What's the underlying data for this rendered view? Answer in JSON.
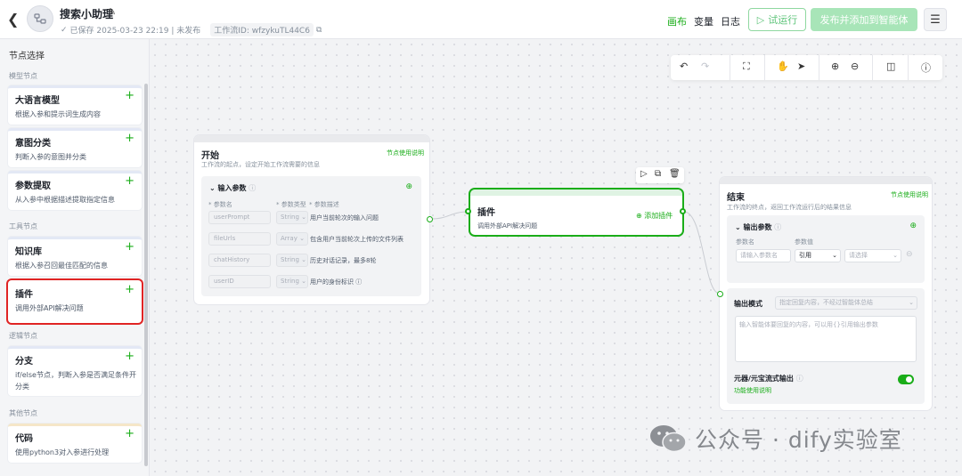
{
  "header": {
    "back": "<",
    "title": "搜索小助理",
    "meta_saved": "已保存 2025-03-23 22:19 | 未发布",
    "workflow_id": "工作流ID: wfzykuTL44C6",
    "tabs": [
      "画布",
      "变量",
      "日志"
    ],
    "active_tab": "画布",
    "run_label": "试运行",
    "publish_label": "发布并添加到智能体",
    "accent": "#1aad19"
  },
  "sidebar": {
    "title": "节点选择",
    "groups": [
      {
        "label": "模型节点",
        "items": [
          {
            "name": "大语言模型",
            "desc": "根据入参和提示词生成内容"
          },
          {
            "name": "意图分类",
            "desc": "判断入参的意图并分类"
          },
          {
            "name": "参数提取",
            "desc": "从入参中根据描述提取指定信息"
          }
        ]
      },
      {
        "label": "工具节点",
        "items": [
          {
            "name": "知识库",
            "desc": "根据入参召回最佳匹配的信息"
          },
          {
            "name": "插件",
            "desc": "调用外部API解决问题"
          }
        ]
      },
      {
        "label": "逻辑节点",
        "items": [
          {
            "name": "分支",
            "desc": "if/else节点，判断入参是否满足条件开分类"
          }
        ]
      },
      {
        "label": "其他节点",
        "items": [
          {
            "name": "代码",
            "desc": "使用python3对入参进行处理"
          }
        ]
      }
    ],
    "add_symbol": "+"
  },
  "start_node": {
    "title": "开始",
    "help": "节点使用说明",
    "desc": "工作流的起点，设定开始工作流需要的信息",
    "section": "输入参数",
    "col_name": "* 参数名",
    "col_type": "* 参数类型",
    "col_desc": "* 参数描述",
    "params": [
      {
        "name": "userPrompt",
        "type": "String",
        "desc": "用户当前轮次的输入问题"
      },
      {
        "name": "fileUrls",
        "type": "Array",
        "desc": "包含用户当前轮次上传的文件列表"
      },
      {
        "name": "chatHistory",
        "type": "String",
        "desc": "历史对话记录，最多8轮"
      },
      {
        "name": "userID",
        "type": "String",
        "desc": "用户的身份标识"
      }
    ]
  },
  "plugin_node": {
    "title": "插件",
    "desc": "调用外部API解决问题",
    "add_label": "添加插件"
  },
  "end_node": {
    "title": "结束",
    "help": "节点使用说明",
    "desc": "工作流的终点，返回工作流运行后的结果信息",
    "section": "输出参数",
    "col_name": "参数名",
    "col_value": "参数值",
    "name_placeholder": "请输入参数名",
    "ref_label": "引用",
    "select_placeholder": "请选择",
    "output_mode_label": "输出模式",
    "output_mode_placeholder": "指定回复内容，不经过智能体总结",
    "answer_placeholder": "输入智能体要回复的内容，可以用{}引用输出参数",
    "stream_label": "元器/元宝流式输出",
    "stream_help": "功能使用说明",
    "stream_on": true
  },
  "watermark": {
    "text": "公众号 · dify实验室"
  }
}
